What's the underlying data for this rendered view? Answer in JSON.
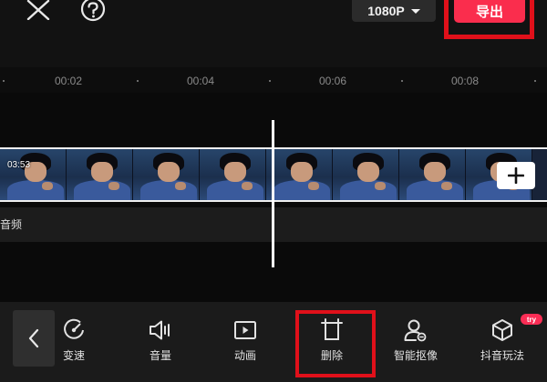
{
  "topbar": {
    "close_icon": "close-icon",
    "help_icon": "question-mark-circle-icon",
    "resolution_label": "1080P",
    "resolution_icon": "caret-down-icon",
    "export_label": "导出",
    "export_color": "#fa2d4d",
    "highlight_color": "#e0101a"
  },
  "timeline": {
    "ticks": [
      "00:02",
      "00:04",
      "00:06",
      "00:08"
    ],
    "clip_duration": "03:53",
    "add_clip_icon": "plus-icon",
    "audio_label": "音频"
  },
  "toolbar": {
    "back_icon": "chevron-left-icon",
    "items": [
      {
        "label": "变速",
        "icon": "speed-gauge-icon"
      },
      {
        "label": "音量",
        "icon": "speaker-volume-icon"
      },
      {
        "label": "动画",
        "icon": "play-frame-icon"
      },
      {
        "label": "删除",
        "icon": "crop-delete-icon"
      },
      {
        "label": "智能抠像",
        "icon": "person-cutout-icon"
      },
      {
        "label": "抖音玩法",
        "icon": "cube-effect-icon"
      }
    ],
    "try_badge": "try"
  }
}
